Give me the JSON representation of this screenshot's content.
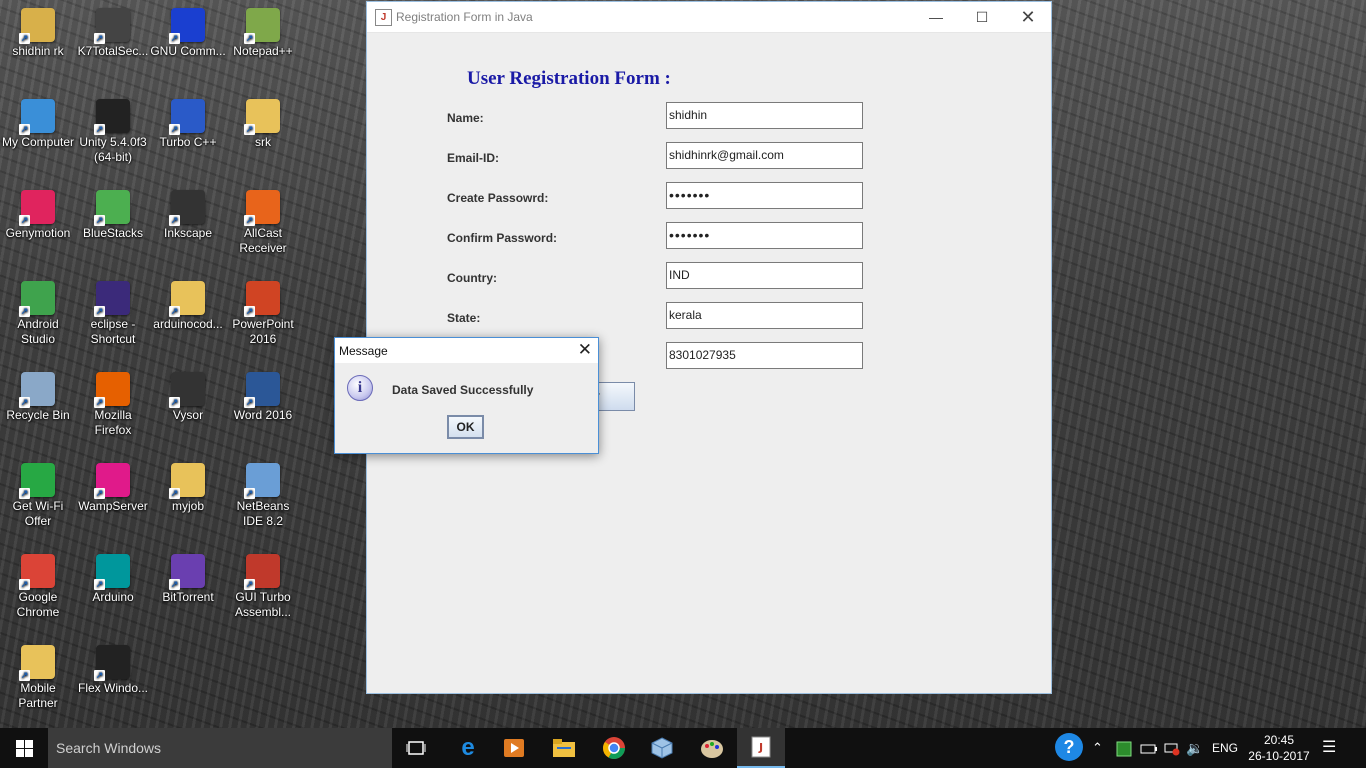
{
  "desktop": {
    "icons": [
      {
        "label": "shidhin rk",
        "glyph": "folder-user-icon",
        "color": "#d8b04a"
      },
      {
        "label": "K7TotalSec...",
        "glyph": "k7-icon",
        "color": "#444444"
      },
      {
        "label": "GNU Comm...",
        "glyph": "gnu-icon",
        "color": "#1a3fd0"
      },
      {
        "label": "Notepad++",
        "glyph": "notepad-icon",
        "color": "#7fa84a"
      },
      {
        "label": "My Computer",
        "glyph": "computer-icon",
        "color": "#3a8fd8"
      },
      {
        "label": "Unity 5.4.0f3 (64-bit)",
        "glyph": "unity-icon",
        "color": "#222222"
      },
      {
        "label": "Turbo C++",
        "glyph": "turbo-icon",
        "color": "#2a5ac8"
      },
      {
        "label": "srk",
        "glyph": "folder-icon",
        "color": "#e8c25a"
      },
      {
        "label": "Genymotion",
        "glyph": "genymotion-icon",
        "color": "#e0245e"
      },
      {
        "label": "BlueStacks",
        "glyph": "bluestacks-icon",
        "color": "#4caf50"
      },
      {
        "label": "Inkscape",
        "glyph": "inkscape-icon",
        "color": "#333333"
      },
      {
        "label": "AllCast Receiver",
        "glyph": "allcast-icon",
        "color": "#e8641b"
      },
      {
        "label": "Android Studio",
        "glyph": "android-studio-icon",
        "color": "#3fa34d"
      },
      {
        "label": "eclipse - Shortcut",
        "glyph": "eclipse-icon",
        "color": "#3b2a7a"
      },
      {
        "label": "arduinocod...",
        "glyph": "file-icon",
        "color": "#e8c25a"
      },
      {
        "label": "PowerPoint 2016",
        "glyph": "powerpoint-icon",
        "color": "#d04423"
      },
      {
        "label": "Recycle Bin",
        "glyph": "recycle-bin-icon",
        "color": "#8aa8c8"
      },
      {
        "label": "Mozilla Firefox",
        "glyph": "firefox-icon",
        "color": "#e66000"
      },
      {
        "label": "Vysor",
        "glyph": "vysor-icon",
        "color": "#333333"
      },
      {
        "label": "Word 2016",
        "glyph": "word-icon",
        "color": "#2b5797"
      },
      {
        "label": "Get Wi-Fi Offer",
        "glyph": "wifi-icon",
        "color": "#27a844"
      },
      {
        "label": "WampServer",
        "glyph": "wamp-icon",
        "color": "#e01a8a"
      },
      {
        "label": "myjob",
        "glyph": "folder-icon",
        "color": "#e8c25a"
      },
      {
        "label": "NetBeans IDE 8.2",
        "glyph": "netbeans-icon",
        "color": "#6a9ed6"
      },
      {
        "label": "Google Chrome",
        "glyph": "chrome-icon",
        "color": "#db4437"
      },
      {
        "label": "Arduino",
        "glyph": "arduino-icon",
        "color": "#00979c"
      },
      {
        "label": "BitTorrent",
        "glyph": "bittorrent-icon",
        "color": "#6a3fb0"
      },
      {
        "label": "GUI Turbo Assembl...",
        "glyph": "assembler-icon",
        "color": "#c0392b"
      },
      {
        "label": "Mobile Partner",
        "glyph": "mobile-partner-icon",
        "color": "#e8c25a"
      },
      {
        "label": "Flex Windo...",
        "glyph": "apple-icon",
        "color": "#222222"
      }
    ]
  },
  "window": {
    "title": "Registration Form in Java",
    "heading": "User Registration Form :",
    "fields": [
      {
        "label": "Name:",
        "value": "shidhin"
      },
      {
        "label": "Email-ID:",
        "value": "shidhinrk@gmail.com"
      },
      {
        "label": "Create Passowrd:",
        "value": "•••••••"
      },
      {
        "label": "Confirm Password:",
        "value": "•••••••"
      },
      {
        "label": "Country:",
        "value": "IND"
      },
      {
        "label": "State:",
        "value": "kerala"
      },
      {
        "label": "",
        "value": "8301027935"
      }
    ],
    "submit_partial": "r"
  },
  "dialog": {
    "title": "Message",
    "message": "Data Saved Successfully",
    "ok_label": "OK"
  },
  "taskbar": {
    "search_placeholder": "Search Windows",
    "language": "ENG",
    "time": "20:45",
    "date": "26-10-2017"
  }
}
